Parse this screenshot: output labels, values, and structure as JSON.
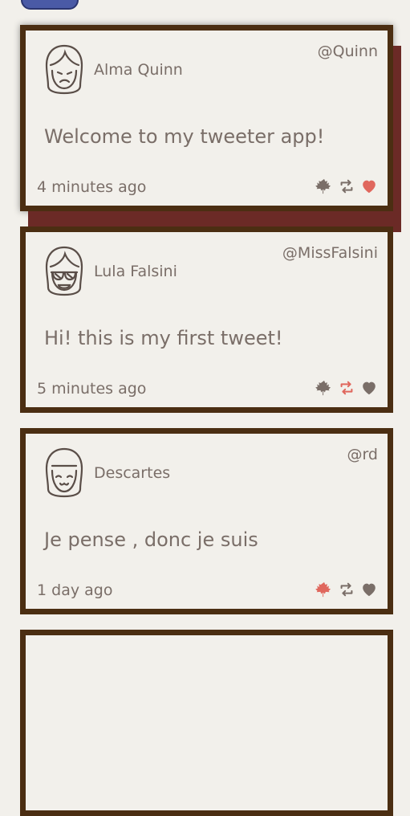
{
  "tweets": [
    {
      "name": "Alma Quinn",
      "handle": "@Quinn",
      "text": "Welcome to my tweeter app!",
      "time": "4 minutes ago",
      "liked": true,
      "retweeted": false,
      "flagged": false
    },
    {
      "name": "Lula Falsini",
      "handle": "@MissFalsini",
      "text": "Hi! this is my first tweet!",
      "time": "5 minutes ago",
      "liked": false,
      "retweeted": true,
      "flagged": false
    },
    {
      "name": "Descartes",
      "handle": "@rd",
      "text": "Je pense , donc je suis",
      "time": "1 day ago",
      "liked": false,
      "retweeted": false,
      "flagged": true
    }
  ],
  "colors": {
    "border": "#4b2e12",
    "text": "#7a6e68",
    "active": "#e0675d",
    "icon": "#7a6e68",
    "hover_shadow": "#6b2a26"
  }
}
